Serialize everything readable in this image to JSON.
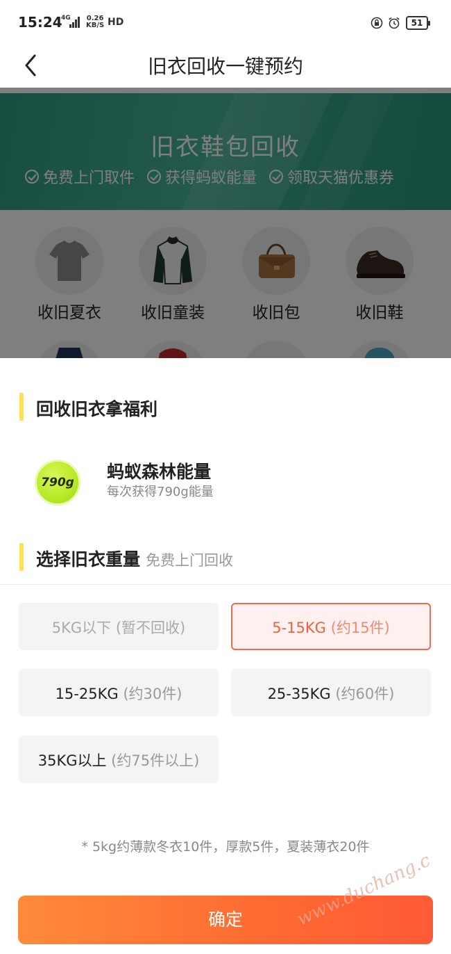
{
  "status_bar": {
    "time": "15:24",
    "network": "4G",
    "speed_value": "0.26",
    "speed_unit": "KB/S",
    "hd": "HD",
    "battery": "51"
  },
  "nav": {
    "title": "旧衣回收一键预约"
  },
  "banner": {
    "title": "旧衣鞋包回收",
    "benefits": [
      "免费上门取件",
      "获得蚂蚁能量",
      "领取天猫优惠券"
    ]
  },
  "categories": [
    {
      "label": "收旧夏衣",
      "icon": "t-shirt-icon"
    },
    {
      "label": "收旧童装",
      "icon": "kids-jacket-icon"
    },
    {
      "label": "收旧包",
      "icon": "handbag-icon"
    },
    {
      "label": "收旧鞋",
      "icon": "shoe-icon"
    }
  ],
  "sheet": {
    "benefit_title": "回收旧衣拿福利",
    "energy_badge": "790g",
    "energy_name": "蚂蚁森林能量",
    "energy_desc": "每次获得790g能量",
    "weight_title": "选择旧衣重量",
    "weight_sub": "免费上门回收",
    "options": [
      {
        "main": "5KG以下",
        "hint": "(暂不回收)",
        "state": "disabled"
      },
      {
        "main": "5-15KG",
        "hint": "(约15件)",
        "state": "selected"
      },
      {
        "main": "15-25KG",
        "hint": "(约30件)",
        "state": "normal"
      },
      {
        "main": "25-35KG",
        "hint": "(约60件)",
        "state": "normal"
      },
      {
        "main": "35KG以上",
        "hint": "(约75件以上)",
        "state": "normal"
      }
    ],
    "footnote": "* 5kg约薄款冬衣10件，厚款5件，夏装薄衣20件",
    "confirm_label": "确定"
  },
  "watermark": "www.duchang.c",
  "colors": {
    "accent": "#ff6a32",
    "selected_border": "#f06a50",
    "section_bar": "#ffe050",
    "banner": "#3aa88c"
  }
}
